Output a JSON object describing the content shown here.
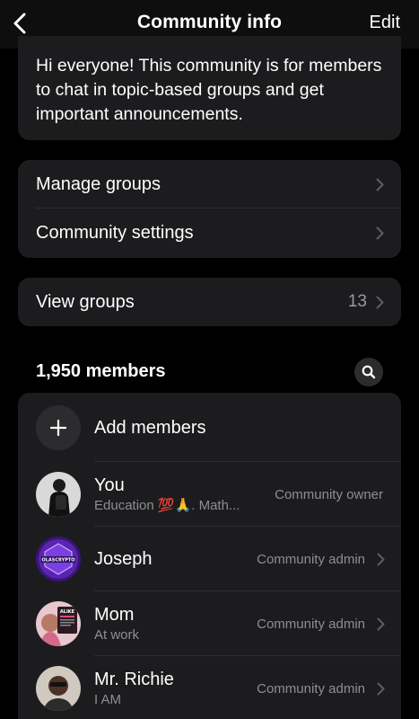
{
  "header": {
    "title": "Community info",
    "edit_label": "Edit"
  },
  "description": {
    "text": "Hi everyone! This community is for members to chat in topic-based groups and get important announcements."
  },
  "menu": {
    "manage_groups": "Manage groups",
    "community_settings": "Community settings"
  },
  "groups": {
    "label": "View groups",
    "count": "13"
  },
  "members": {
    "heading": "1,950 members",
    "add_label": "Add members",
    "list": [
      {
        "name": "You",
        "subtitle": "Education 💯🙏. Math...",
        "role": "Community owner"
      },
      {
        "name": "Joseph",
        "subtitle": "",
        "role": "Community admin"
      },
      {
        "name": "Mom",
        "subtitle": "At work",
        "role": "Community admin"
      },
      {
        "name": "Mr. Richie",
        "subtitle": "I AM",
        "role": "Community admin"
      }
    ]
  },
  "colors": {
    "background": "#000000",
    "card": "#1c1c1e",
    "secondary_text": "#8e8e93",
    "accent_purple": "#6b2fc9"
  }
}
